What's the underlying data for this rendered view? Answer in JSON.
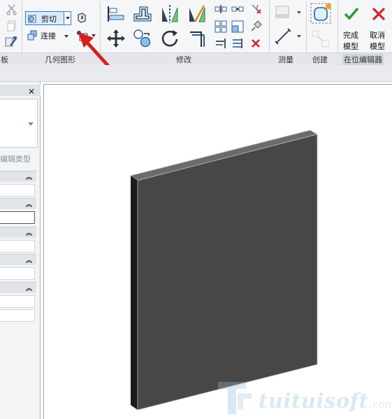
{
  "ribbon": {
    "panels": {
      "clipboard": "板",
      "geometry": "几何图形",
      "modify": "修改",
      "measure": "测量",
      "create": "创建",
      "in_place_editor": "在位编辑器"
    },
    "geometry": {
      "cut_label": "剪切",
      "join_label": "连接"
    },
    "editor": {
      "finish_label_1": "完成",
      "finish_label_2": "模型",
      "cancel_label_1": "取消",
      "cancel_label_2": "模型"
    }
  },
  "properties": {
    "edit_type_label": "编辑类型"
  },
  "watermark": {
    "brand": "tuituisoft",
    "suffix": ".com"
  },
  "colors": {
    "accent": "#1e6fc7",
    "finish_check": "#2e9a3a",
    "cancel_x": "#d3222a",
    "arrow": "#d81e1e",
    "wall_front": "#474747",
    "wall_top": "#6b6b6b",
    "wall_side": "#1c1c1c"
  }
}
